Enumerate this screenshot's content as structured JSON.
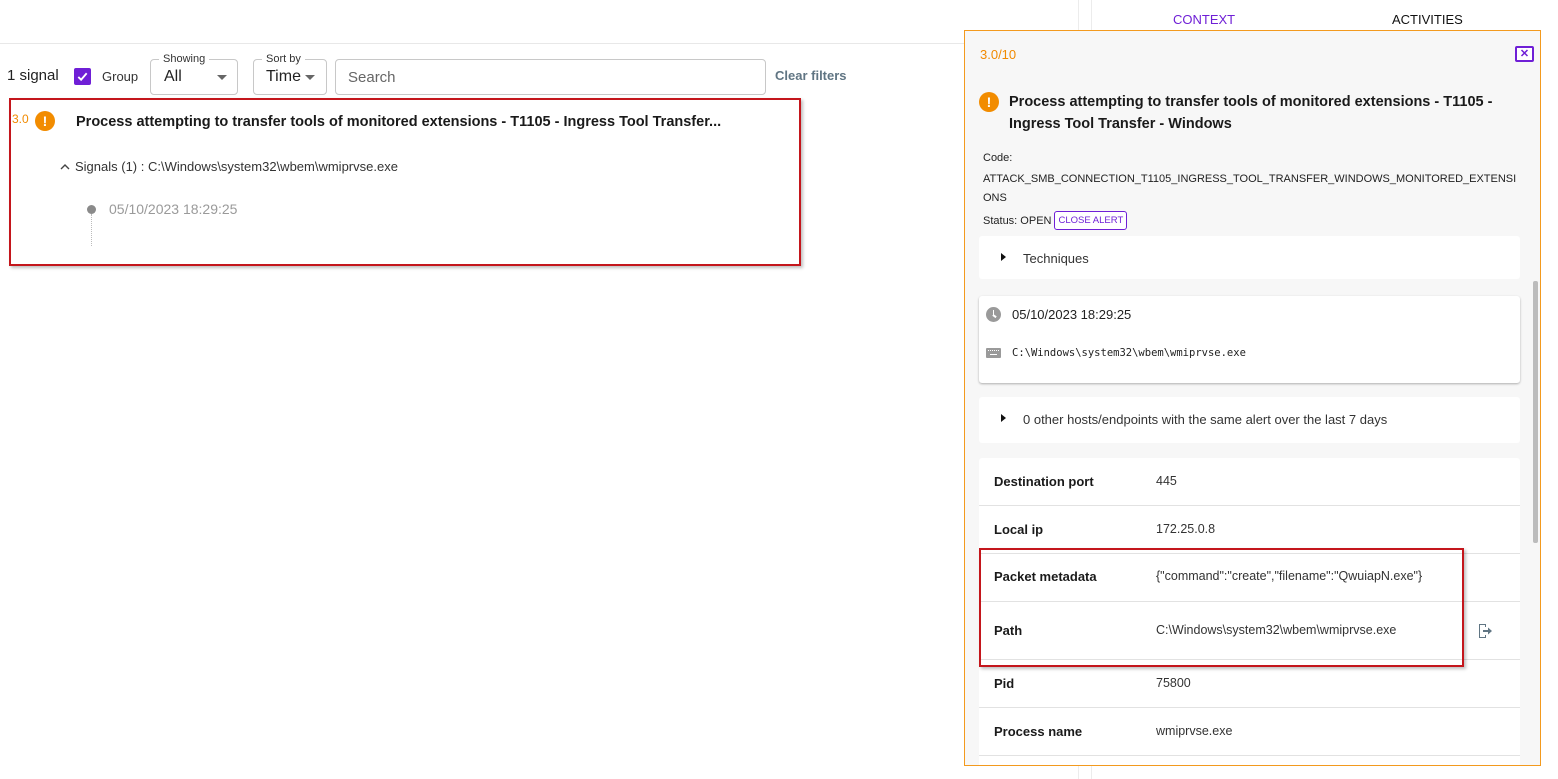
{
  "filters": {
    "signal_count": "1 signal",
    "group_label": "Group",
    "group_checked": true,
    "showing_label": "Showing",
    "showing_value": "All",
    "sort_label": "Sort by",
    "sort_value": "Time",
    "search_placeholder": "Search",
    "search_value": "",
    "clear_filters": "Clear filters"
  },
  "signal_card": {
    "score": "3.0",
    "severity_icon": "warning-icon",
    "title": "Process attempting to transfer tools of monitored extensions - T1105 - Ingress Tool Transfer...",
    "signals_summary": "Signals (1) : C:\\Windows\\system32\\wbem\\wmiprvse.exe",
    "timeline": [
      {
        "timestamp": "05/10/2023 18:29:25"
      }
    ]
  },
  "tabs": [
    {
      "label": "CONTEXT",
      "active": true
    },
    {
      "label": "ACTIVITIES",
      "active": false
    }
  ],
  "detail": {
    "score": "3.0/10",
    "close_icon": "close-icon",
    "title": "Process attempting to transfer tools of monitored extensions - T1105 - Ingress Tool Transfer - Windows",
    "code_label": "Code:",
    "code": "ATTACK_SMB_CONNECTION_T1105_INGRESS_TOOL_TRANSFER_WINDOWS_MONITORED_EXTENSIONS",
    "status_label": "Status: OPEN",
    "close_alert": "CLOSE ALERT",
    "techniques_label": "Techniques",
    "event_time": "05/10/2023 18:29:25",
    "event_command": "C:\\Windows\\system32\\wbem\\wmiprvse.exe",
    "other_hosts": "0 other hosts/endpoints with the same alert over the last 7 days",
    "properties": [
      {
        "key": "Destination port",
        "value": "445"
      },
      {
        "key": "Local ip",
        "value": "172.25.0.8"
      },
      {
        "key": "Packet metadata",
        "value": "{\"command\":\"create\",\"filename\":\"QwuiapN.exe\"}"
      },
      {
        "key": "Path",
        "value": "C:\\Windows\\system32\\wbem\\wmiprvse.exe"
      },
      {
        "key": "Pid",
        "value": "75800"
      },
      {
        "key": "Process name",
        "value": "wmiprvse.exe"
      }
    ]
  },
  "colors": {
    "accent": "#6f1fd6",
    "severity": "#f28c00",
    "highlight": "#c4161c",
    "panel_border": "#f39a1e"
  }
}
